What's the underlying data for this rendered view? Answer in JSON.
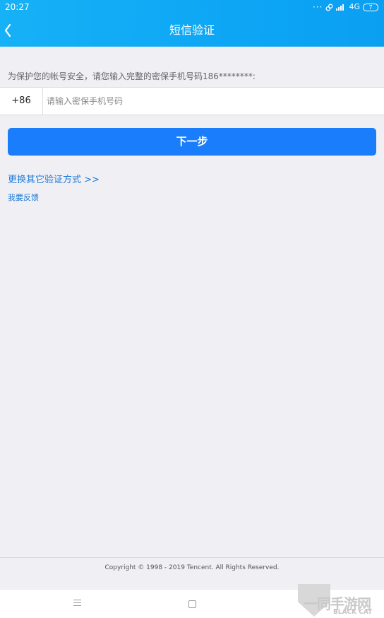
{
  "status_bar": {
    "time": "20:27",
    "dots": "···",
    "network": "4G",
    "battery": "7"
  },
  "nav": {
    "title": "短信验证"
  },
  "form": {
    "tip": "为保护您的帐号安全，请您输入完整的密保手机号码186********:",
    "country_code": "+86",
    "phone_placeholder": "请输入密保手机号码",
    "phone_value": "",
    "next_label": "下一步"
  },
  "links": {
    "switch_method": "更换其它验证方式 >>",
    "feedback": "我要反馈"
  },
  "footer": {
    "copyright": "Copyright © 1998 - 2019 Tencent. All Rights Reserved."
  },
  "watermark": {
    "cn": "一同手游网",
    "en": "BLACK CAT"
  },
  "colors": {
    "header": "#16b1f6",
    "button": "#1a7dfb",
    "link": "#1d7ad8",
    "background": "#efeff4"
  },
  "icons": {
    "back": "chevron-left-icon",
    "link_status": "link-icon",
    "signal": "signal-icon",
    "battery": "battery-icon",
    "menu": "menu-icon",
    "home": "home-icon"
  }
}
